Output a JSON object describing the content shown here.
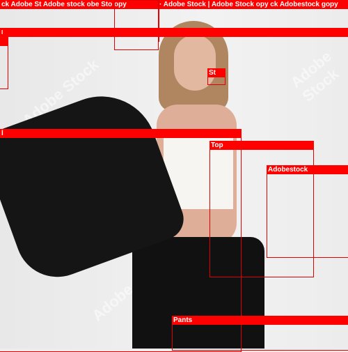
{
  "watermark": "Adobe Stock",
  "labels": {
    "top_left": "ck Adobe St Adobe stock obe Sto opy",
    "top_right": "· Adobe Stock | Adobe Stock opy ck Adobestock gopy",
    "wide_bar": "I",
    "earring": "St",
    "jacket": "l",
    "top": "Top",
    "adobestock": "Adobestock",
    "pants": "Pants"
  }
}
